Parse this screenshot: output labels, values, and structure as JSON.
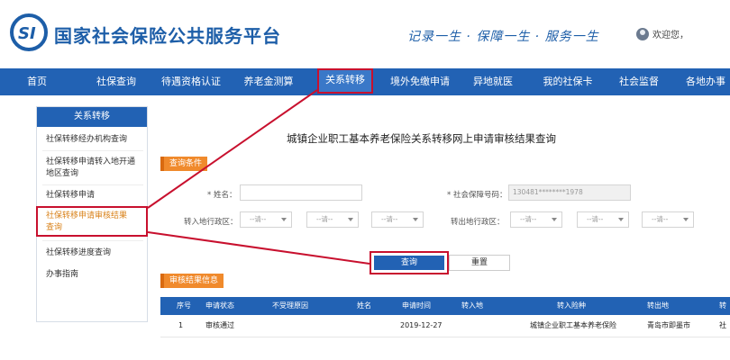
{
  "header": {
    "site_title": "国家社会保险公共服务平台",
    "slogan": "记录一生 · 保障一生 · 服务一生",
    "welcome": "欢迎您，"
  },
  "nav": {
    "items": [
      {
        "label": "首页"
      },
      {
        "label": "社保查询"
      },
      {
        "label": "待遇资格认证"
      },
      {
        "label": "养老金测算"
      },
      {
        "label": "关系转移"
      },
      {
        "label": "境外免缴申请"
      },
      {
        "label": "异地就医"
      },
      {
        "label": "我的社保卡"
      },
      {
        "label": "社会监督"
      },
      {
        "label": "各地办事"
      }
    ],
    "active_index": 4
  },
  "sidebar": {
    "title": "关系转移",
    "items": [
      {
        "label": "社保转移经办机构查询"
      },
      {
        "label": "社保转移申请转入地开通地区查询"
      },
      {
        "label": "社保转移申请"
      },
      {
        "label": "社保转移申请审核结果查询"
      },
      {
        "label": "社保转移进度查询"
      },
      {
        "label": "办事指南"
      }
    ],
    "selected_index": 3
  },
  "main": {
    "title": "城镇企业职工基本养老保险关系转移网上申请审核结果查询",
    "query_section_label": "查询条件",
    "name_label": "* 姓名：",
    "ssn_label": "* 社会保障号码：",
    "ssn_value": "130481********1978",
    "in_region_label": "转入地行政区：",
    "out_region_label": "转出地行政区：",
    "select_placeholder": "--请--",
    "query_button": "查询",
    "reset_button": "重置",
    "result_section_label": "审核结果信息"
  },
  "table": {
    "headers": [
      "序号",
      "申请状态",
      "不受理原因",
      "姓名",
      "申请时间",
      "转入地",
      "转入险种",
      "转出地",
      "转"
    ],
    "rows": [
      [
        "1",
        "审核通过",
        "",
        "",
        "2019-12-27",
        "",
        "城镇企业职工基本养老保险",
        "青岛市即墨市",
        "社"
      ]
    ]
  },
  "colors": {
    "brand_blue": "#2262b4",
    "annotation_red": "#c8102e",
    "section_orange": "#f08a2c",
    "selected_text": "#d9821a"
  }
}
